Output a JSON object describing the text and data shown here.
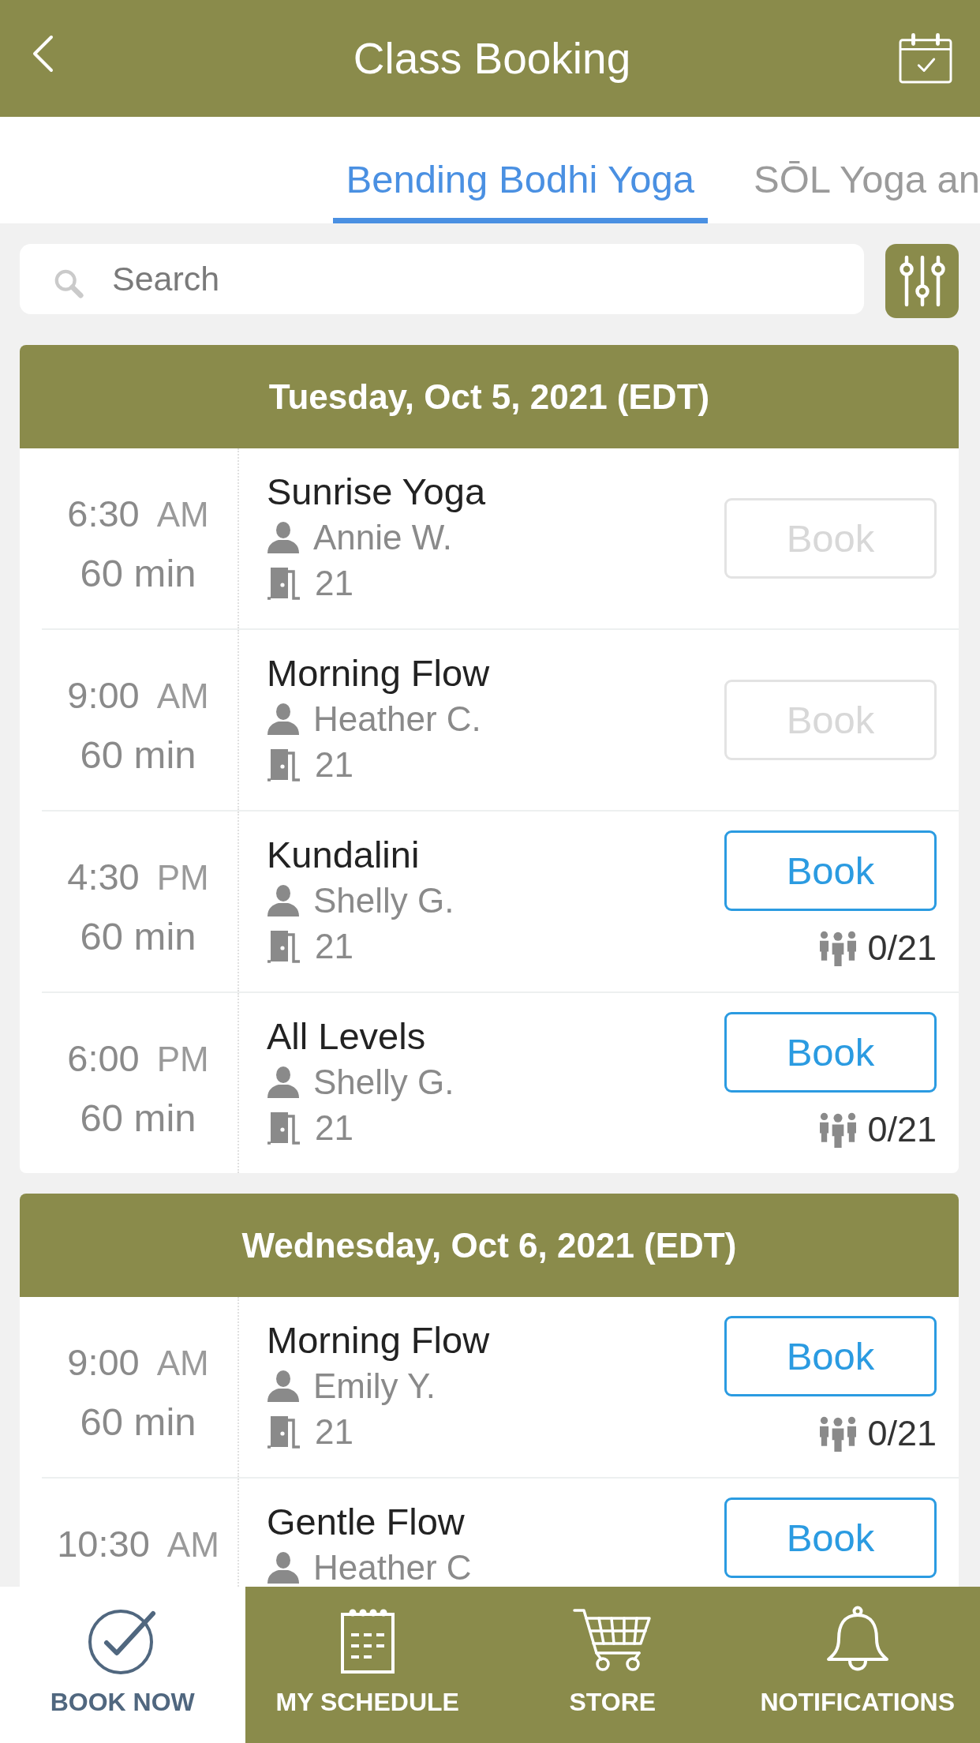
{
  "header": {
    "title": "Class Booking"
  },
  "tabs": [
    {
      "label": "Bending Bodhi Yoga",
      "selected": true
    },
    {
      "label": "SŌL Yoga an",
      "selected": false
    }
  ],
  "search": {
    "placeholder": "Search"
  },
  "days": [
    {
      "date": "Tuesday, Oct 5, 2021 (EDT)",
      "classes": [
        {
          "time": "6:30",
          "period": "AM",
          "duration": "60 min",
          "name": "Sunrise Yoga",
          "instructor": "Annie W.",
          "room": "21",
          "action": "Book",
          "disabled": true
        },
        {
          "time": "9:00",
          "period": "AM",
          "duration": "60 min",
          "name": "Morning Flow",
          "instructor": "Heather C.",
          "room": "21",
          "action": "Book",
          "disabled": true
        },
        {
          "time": "4:30",
          "period": "PM",
          "duration": "60 min",
          "name": "Kundalini",
          "instructor": "Shelly G.",
          "room": "21",
          "action": "Book",
          "disabled": false,
          "capacity": "0/21"
        },
        {
          "time": "6:00",
          "period": "PM",
          "duration": "60 min",
          "name": "All Levels",
          "instructor": "Shelly G.",
          "room": "21",
          "action": "Book",
          "disabled": false,
          "capacity": "0/21"
        }
      ]
    },
    {
      "date": "Wednesday, Oct 6, 2021 (EDT)",
      "classes": [
        {
          "time": "9:00",
          "period": "AM",
          "duration": "60 min",
          "name": "Morning Flow",
          "instructor": "Emily Y.",
          "room": "21",
          "action": "Book",
          "disabled": false,
          "capacity": "0/21"
        },
        {
          "time": "10:30",
          "period": "AM",
          "name": "Gentle Flow",
          "instructor": "Heather C",
          "action": "Book",
          "disabled": false
        }
      ]
    }
  ],
  "bottom_nav": [
    {
      "label": "BOOK NOW",
      "selected": true
    },
    {
      "label": "MY SCHEDULE",
      "selected": false
    },
    {
      "label": "STORE",
      "selected": false
    },
    {
      "label": "NOTIFICATIONS",
      "selected": false
    }
  ]
}
